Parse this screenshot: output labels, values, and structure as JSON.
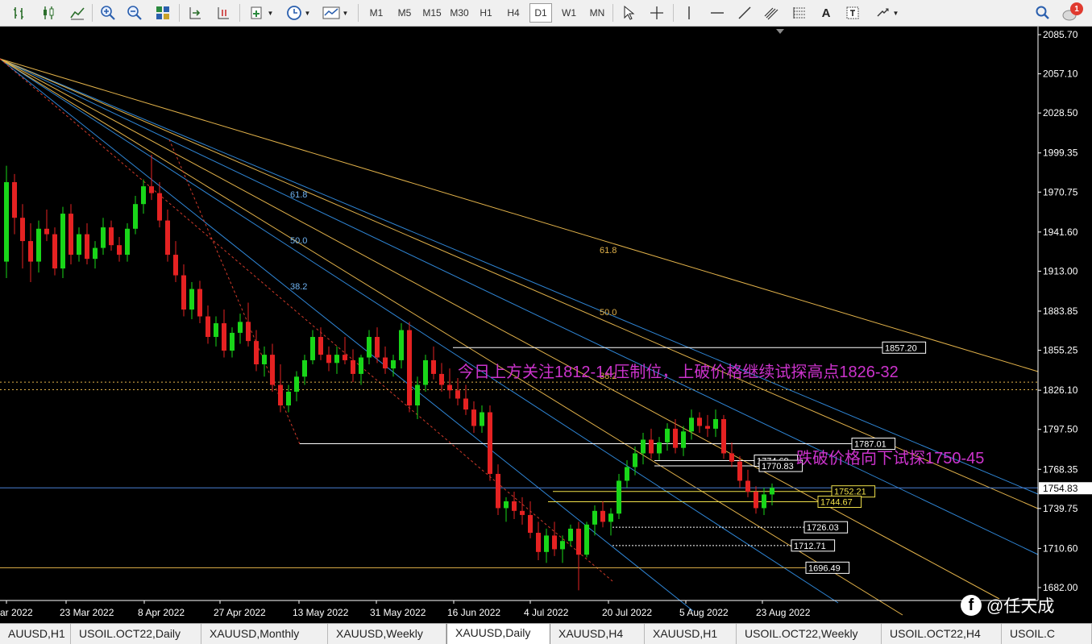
{
  "toolbar": {
    "timeframes": [
      "M1",
      "M5",
      "M15",
      "M30",
      "H1",
      "H4",
      "D1",
      "W1",
      "MN"
    ],
    "active_timeframe": "D1",
    "notification_count": "1"
  },
  "chart_data": {
    "type": "candlestick",
    "symbol": "XAUUSD",
    "timeframe": "Daily",
    "price_axis": {
      "range": [
        1682.0,
        2085.7
      ],
      "ticks": [
        "2085.70",
        "2057.10",
        "2028.50",
        "1999.35",
        "1970.75",
        "1941.60",
        "1913.00",
        "1883.85",
        "1855.25",
        "1826.10",
        "1797.50",
        "1768.35",
        "1739.75",
        "1710.60",
        "1682.00"
      ]
    },
    "current_price": "1754.83",
    "date_labels": [
      "ar 2022",
      "23 Mar 2022",
      "8 Apr 2022",
      "27 Apr 2022",
      "13 May 2022",
      "31 May 2022",
      "16 Jun 2022",
      "4 Jul 2022",
      "20 Jul 2022",
      "5 Aug 2022",
      "23 Aug 2022"
    ],
    "price_labels": [
      "1857.20",
      "1787.01",
      "1774.69",
      "1770.83",
      "1752.21",
      "1744.67",
      "1726.03",
      "1712.71",
      "1696.49"
    ],
    "fib_labels_blue": [
      "61.8",
      "50.0",
      "38.2"
    ],
    "fib_labels_orange": [
      "61.8",
      "50.0",
      "38.2"
    ],
    "annotations": [
      "今日上方关注1812-14压制位，上破价格继续试探高点1826-32",
      "跌破价格向下试探1750-45"
    ],
    "candles": [
      [
        1920,
        1990,
        1908,
        1978
      ],
      [
        1978,
        1984,
        1940,
        1952
      ],
      [
        1952,
        1962,
        1915,
        1935
      ],
      [
        1935,
        1948,
        1905,
        1920
      ],
      [
        1920,
        1950,
        1912,
        1944
      ],
      [
        1944,
        1958,
        1935,
        1940
      ],
      [
        1940,
        1945,
        1910,
        1915
      ],
      [
        1915,
        1960,
        1908,
        1955
      ],
      [
        1955,
        1962,
        1918,
        1925
      ],
      [
        1925,
        1945,
        1920,
        1940
      ],
      [
        1940,
        1948,
        1918,
        1922
      ],
      [
        1922,
        1935,
        1915,
        1930
      ],
      [
        1930,
        1952,
        1925,
        1945
      ],
      [
        1945,
        1950,
        1928,
        1932
      ],
      [
        1932,
        1938,
        1920,
        1925
      ],
      [
        1925,
        1948,
        1920,
        1944
      ],
      [
        1944,
        1968,
        1940,
        1962
      ],
      [
        1962,
        1980,
        1955,
        1975
      ],
      [
        1975,
        1998,
        1965,
        1970
      ],
      [
        1970,
        1978,
        1945,
        1950
      ],
      [
        1950,
        1958,
        1920,
        1925
      ],
      [
        1925,
        1935,
        1905,
        1910
      ],
      [
        1910,
        1918,
        1880,
        1885
      ],
      [
        1885,
        1905,
        1878,
        1900
      ],
      [
        1900,
        1906,
        1875,
        1880
      ],
      [
        1880,
        1888,
        1860,
        1865
      ],
      [
        1865,
        1880,
        1858,
        1875
      ],
      [
        1875,
        1885,
        1850,
        1855
      ],
      [
        1855,
        1872,
        1850,
        1868
      ],
      [
        1868,
        1882,
        1860,
        1876
      ],
      [
        1876,
        1890,
        1858,
        1862
      ],
      [
        1862,
        1870,
        1840,
        1845
      ],
      [
        1845,
        1858,
        1836,
        1852
      ],
      [
        1852,
        1860,
        1825,
        1830
      ],
      [
        1830,
        1845,
        1810,
        1815
      ],
      [
        1815,
        1830,
        1810,
        1825
      ],
      [
        1825,
        1840,
        1818,
        1836
      ],
      [
        1836,
        1852,
        1830,
        1848
      ],
      [
        1848,
        1870,
        1845,
        1865
      ],
      [
        1865,
        1872,
        1848,
        1852
      ],
      [
        1852,
        1858,
        1840,
        1846
      ],
      [
        1846,
        1858,
        1838,
        1852
      ],
      [
        1852,
        1865,
        1845,
        1848
      ],
      [
        1848,
        1856,
        1832,
        1838
      ],
      [
        1838,
        1852,
        1830,
        1850
      ],
      [
        1850,
        1870,
        1845,
        1865
      ],
      [
        1865,
        1872,
        1846,
        1850
      ],
      [
        1850,
        1858,
        1838,
        1842
      ],
      [
        1842,
        1852,
        1836,
        1848
      ],
      [
        1848,
        1875,
        1842,
        1870
      ],
      [
        1870,
        1876,
        1810,
        1815
      ],
      [
        1815,
        1836,
        1805,
        1830
      ],
      [
        1830,
        1852,
        1825,
        1848
      ],
      [
        1848,
        1858,
        1834,
        1838
      ],
      [
        1838,
        1846,
        1825,
        1830
      ],
      [
        1830,
        1842,
        1820,
        1826
      ],
      [
        1826,
        1835,
        1815,
        1820
      ],
      [
        1820,
        1830,
        1808,
        1812
      ],
      [
        1812,
        1818,
        1795,
        1800
      ],
      [
        1800,
        1815,
        1795,
        1810
      ],
      [
        1810,
        1815,
        1760,
        1765
      ],
      [
        1765,
        1772,
        1735,
        1740
      ],
      [
        1740,
        1748,
        1730,
        1745
      ],
      [
        1745,
        1752,
        1732,
        1738
      ],
      [
        1738,
        1748,
        1728,
        1735
      ],
      [
        1735,
        1745,
        1718,
        1722
      ],
      [
        1722,
        1730,
        1702,
        1708
      ],
      [
        1708,
        1725,
        1700,
        1720
      ],
      [
        1720,
        1730,
        1705,
        1710
      ],
      [
        1710,
        1720,
        1700,
        1716
      ],
      [
        1716,
        1728,
        1712,
        1725
      ],
      [
        1725,
        1730,
        1680,
        1706
      ],
      [
        1706,
        1730,
        1704,
        1728
      ],
      [
        1728,
        1742,
        1720,
        1738
      ],
      [
        1738,
        1745,
        1726,
        1730
      ],
      [
        1730,
        1740,
        1720,
        1736
      ],
      [
        1736,
        1765,
        1732,
        1760
      ],
      [
        1760,
        1775,
        1755,
        1770
      ],
      [
        1770,
        1785,
        1764,
        1780
      ],
      [
        1780,
        1795,
        1772,
        1790
      ],
      [
        1790,
        1798,
        1776,
        1780
      ],
      [
        1780,
        1792,
        1775,
        1788
      ],
      [
        1788,
        1802,
        1782,
        1798
      ],
      [
        1798,
        1805,
        1780,
        1784
      ],
      [
        1784,
        1800,
        1778,
        1796
      ],
      [
        1796,
        1812,
        1790,
        1806
      ],
      [
        1806,
        1810,
        1795,
        1800
      ],
      [
        1800,
        1808,
        1792,
        1798
      ],
      [
        1798,
        1812,
        1792,
        1805
      ],
      [
        1805,
        1808,
        1776,
        1780
      ],
      [
        1780,
        1788,
        1770,
        1774
      ],
      [
        1774,
        1778,
        1755,
        1760
      ],
      [
        1760,
        1768,
        1748,
        1752
      ],
      [
        1752,
        1756,
        1736,
        1740
      ],
      [
        1740,
        1755,
        1735,
        1750
      ],
      [
        1750,
        1758,
        1742,
        1754.83
      ]
    ]
  },
  "tabs": [
    "AUUSD,H1",
    "USOIL.OCT22,Daily",
    "XAUUSD,Monthly",
    "XAUUSD,Weekly",
    "XAUUSD,Daily",
    "XAUUSD,H4",
    "XAUUSD,H1",
    "USOIL.OCT22,Weekly",
    "USOIL.OCT22,H4",
    "USOIL.C"
  ],
  "active_tab": "XAUUSD,Daily",
  "watermark": {
    "text": "@任天成"
  }
}
